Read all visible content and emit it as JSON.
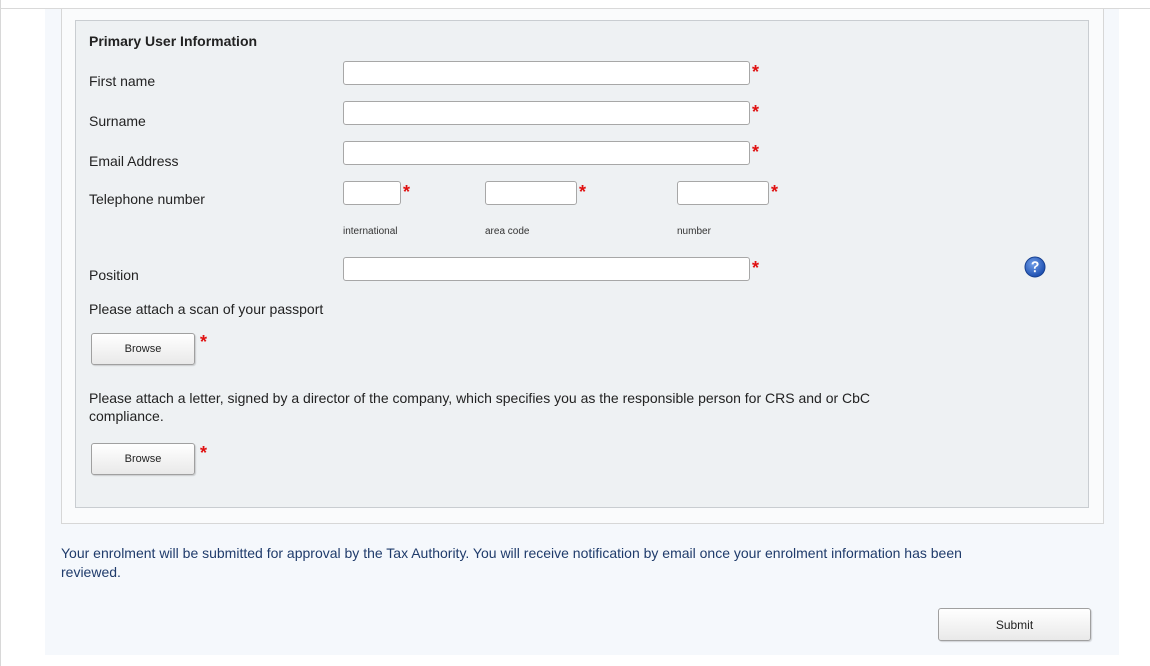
{
  "form": {
    "legend": "Primary User Information",
    "fields": {
      "first_name": {
        "label": "First name",
        "value": "",
        "required_mark": "*"
      },
      "surname": {
        "label": "Surname",
        "value": "",
        "required_mark": "*"
      },
      "email": {
        "label": "Email Address",
        "value": "",
        "required_mark": "*"
      },
      "telephone": {
        "label": "Telephone number",
        "international": {
          "sublabel": "international",
          "value": "",
          "required_mark": "*"
        },
        "area_code": {
          "sublabel": "area code",
          "value": "",
          "required_mark": "*"
        },
        "number": {
          "sublabel": "number",
          "value": "",
          "required_mark": "*"
        }
      },
      "position": {
        "label": "Position",
        "value": "",
        "required_mark": "*",
        "help_icon": "question-circle-icon"
      }
    },
    "passport": {
      "prompt": "Please attach a scan of your passport",
      "button": "Browse",
      "required_mark": "*"
    },
    "letter": {
      "prompt_line1": "Please attach a letter, signed by a director of the company, which specifies you as the responsible person for CRS and or CbC",
      "prompt_line2": "compliance.",
      "button": "Browse",
      "required_mark": "*"
    }
  },
  "notice": {
    "line1": "Your enrolment will be submitted for approval by the Tax Authority. You will receive notification by email once your enrolment information has been",
    "line2": "reviewed."
  },
  "submit": {
    "label": "Submit"
  },
  "colors": {
    "required": "#e01010",
    "notice_text": "#1f3b6b",
    "help_icon": "#2a63c4",
    "fieldset_bg": "#eef1f3"
  }
}
